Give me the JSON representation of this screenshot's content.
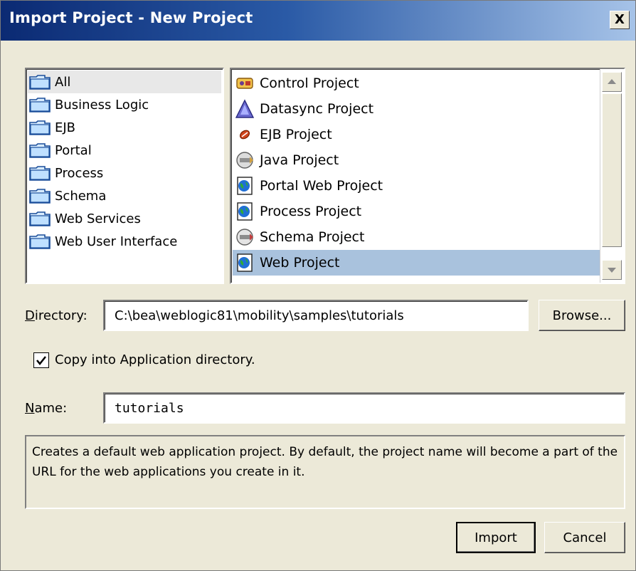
{
  "window": {
    "title": "Import Project - New Project",
    "close_glyph": "X"
  },
  "categories": [
    "All",
    "Business Logic",
    "EJB",
    "Portal",
    "Process",
    "Schema",
    "Web Services",
    "Web User Interface"
  ],
  "selected_category": "All",
  "projects": [
    {
      "label": "Control Project",
      "icon": "control-project-icon"
    },
    {
      "label": "Datasync Project",
      "icon": "datasync-project-icon"
    },
    {
      "label": "EJB Project",
      "icon": "ejb-project-icon"
    },
    {
      "label": "Java Project",
      "icon": "java-project-icon"
    },
    {
      "label": "Portal Web Project",
      "icon": "globe-icon"
    },
    {
      "label": "Process Project",
      "icon": "globe-icon"
    },
    {
      "label": "Schema Project",
      "icon": "schema-project-icon"
    },
    {
      "label": "Web Project",
      "icon": "globe-icon"
    }
  ],
  "selected_project": "Web Project",
  "directory": {
    "label_first": "D",
    "label_rest": "irectory:",
    "value": "C:\\bea\\weblogic81\\mobility\\samples\\tutorials",
    "browse_label": "Browse..."
  },
  "copy_option": {
    "label": "Copy into Application directory.",
    "checked": true
  },
  "name": {
    "label_first": "N",
    "label_rest": "ame:",
    "value": "tutorials"
  },
  "description": "Creates a default web application project. By default, the project name will become a part of the URL for the web applications you create in it.",
  "buttons": {
    "import": "Import",
    "cancel": "Cancel"
  }
}
